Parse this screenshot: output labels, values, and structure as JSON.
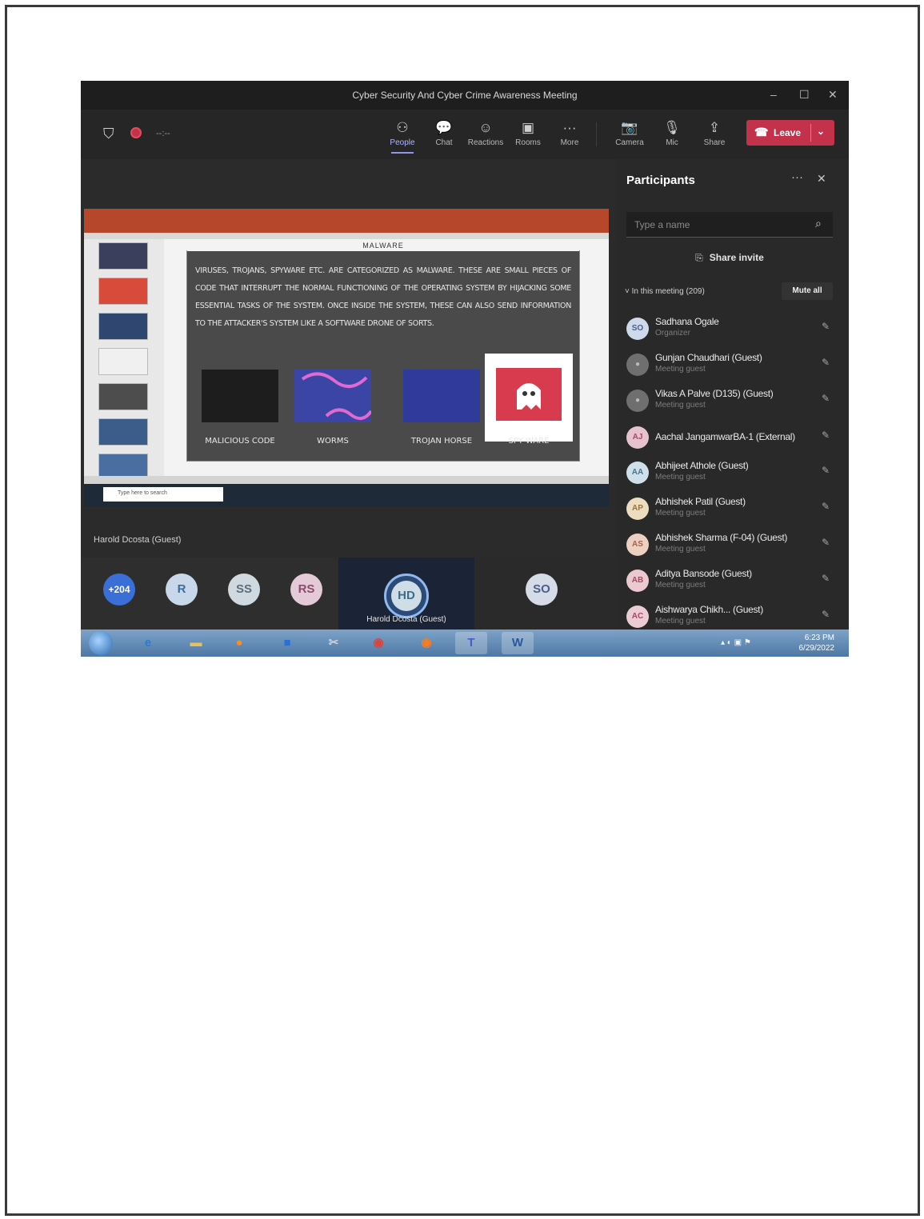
{
  "window": {
    "title": "Cyber Security And Cyber Crime Awareness Meeting",
    "controls": {
      "minimize": "–",
      "maximize": "☐",
      "close": "✕"
    }
  },
  "toolbar": {
    "timer": "--:--",
    "buttons": {
      "people": "People",
      "chat": "Chat",
      "reactions": "Reactions",
      "rooms": "Rooms",
      "more": "More",
      "camera": "Camera",
      "mic": "Mic",
      "share": "Share"
    },
    "leave_label": "Leave"
  },
  "shared_screen": {
    "slide_title": "MALWARE",
    "slide_text": "Viruses, trojans, spyware etc. are categorized as malware. These are small pieces of code that interrupt the normal functioning of the operating system by hijacking some essential tasks of the system. Once inside the system, these can also send information to the attacker's system like a software drone of sorts.",
    "captions": [
      "MALICIOUS CODE",
      "WORMS",
      "TROJAN HORSE",
      "SPY WARE"
    ],
    "taskbar_search_placeholder": "Type here to search"
  },
  "presenter": {
    "name": "Harold Dcosta (Guest)"
  },
  "gallery": {
    "overflow_count": "+204",
    "avatars": [
      "R",
      "SS",
      "RS"
    ],
    "active_tile": {
      "initials": "HD",
      "name": "Harold Dcosta (Guest)"
    },
    "so_tile": {
      "initials": "SO"
    }
  },
  "participants_panel": {
    "title": "Participants",
    "search_placeholder": "Type a name",
    "share_invite": "Share invite",
    "section_label": "In this meeting (209)",
    "mute_all": "Mute all",
    "people": [
      {
        "initials": "SO",
        "name": "Sadhana Ogale",
        "role": "Organizer"
      },
      {
        "initials": "",
        "name": "Gunjan Chaudhari (Guest)",
        "role": "Meeting guest"
      },
      {
        "initials": "",
        "name": "Vikas A Palve (D135) (Guest)",
        "role": "Meeting guest"
      },
      {
        "initials": "AJ",
        "name": "Aachal JangamwarBA-1 (External)",
        "role": ""
      },
      {
        "initials": "AA",
        "name": "Abhijeet Athole (Guest)",
        "role": "Meeting guest"
      },
      {
        "initials": "AP",
        "name": "Abhishek Patil (Guest)",
        "role": "Meeting guest"
      },
      {
        "initials": "AS",
        "name": "Abhishek Sharma (F-04) (Guest)",
        "role": "Meeting guest"
      },
      {
        "initials": "AB",
        "name": "Aditya Bansode (Guest)",
        "role": "Meeting guest"
      },
      {
        "initials": "AC",
        "name": "Aishwarya Chikh... (Guest)",
        "role": "Meeting guest"
      }
    ]
  },
  "os_taskbar": {
    "word_label": "W",
    "time": "6:23 PM",
    "date": "6/29/2022"
  },
  "colors": {
    "leave": "#c4314b",
    "accent": "#8f96e8",
    "ppt_ribbon": "#b7472a"
  }
}
